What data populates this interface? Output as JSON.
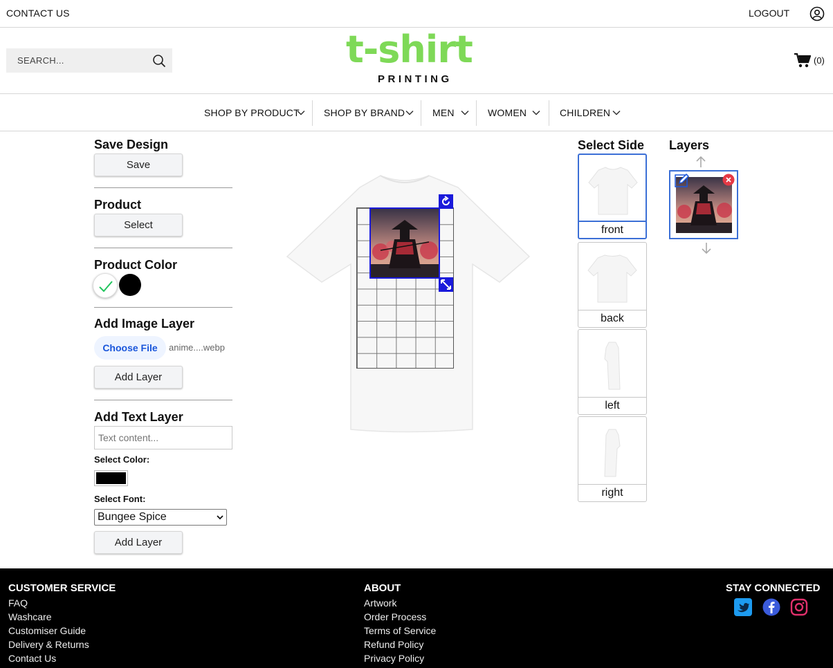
{
  "topbar": {
    "contact": "CONTACT US",
    "logout": "LOGOUT"
  },
  "header": {
    "search_placeholder": "SEARCH...",
    "logo_text": "t-shirt",
    "logo_sub": "PRINTING",
    "cart_count": "(0)",
    "brand_color": "#7ed957"
  },
  "nav": {
    "items": [
      {
        "label": "SHOP BY PRODUCT"
      },
      {
        "label": "SHOP BY BRAND"
      },
      {
        "label": "MEN"
      },
      {
        "label": "WOMEN"
      },
      {
        "label": "CHILDREN"
      }
    ]
  },
  "left": {
    "save_title": "Save Design",
    "save_btn": "Save",
    "product_title": "Product",
    "product_btn": "Select",
    "color_title": "Product Color",
    "colors": [
      {
        "name": "white",
        "hex": "#ffffff",
        "selected": true
      },
      {
        "name": "black",
        "hex": "#000000",
        "selected": false
      }
    ],
    "image_title": "Add Image Layer",
    "choose_file": "Choose File",
    "file_name": "anime....webp",
    "add_image_btn": "Add Layer",
    "text_title": "Add Text Layer",
    "text_placeholder": "Text content...",
    "select_color_label": "Select Color:",
    "text_color": "#000000",
    "select_font_label": "Select Font:",
    "font_value": "Bungee Spice",
    "add_text_btn": "Add Layer"
  },
  "sides": {
    "title": "Select Side",
    "items": [
      {
        "label": "front",
        "active": true
      },
      {
        "label": "back",
        "active": false
      },
      {
        "label": "left",
        "active": false
      },
      {
        "label": "right",
        "active": false
      }
    ]
  },
  "layers": {
    "title": "Layers"
  },
  "footer": {
    "customer_service": {
      "title": "CUSTOMER SERVICE",
      "links": [
        "FAQ",
        "Washcare",
        "Customiser Guide",
        "Delivery & Returns",
        "Contact Us"
      ]
    },
    "about": {
      "title": "ABOUT",
      "links": [
        "Artwork",
        "Order Process",
        "Terms of Service",
        "Refund Policy",
        "Privacy Policy"
      ]
    },
    "stay_connected": {
      "title": "STAY CONNECTED",
      "icons": [
        "twitter-icon",
        "facebook-icon",
        "instagram-icon"
      ]
    }
  }
}
